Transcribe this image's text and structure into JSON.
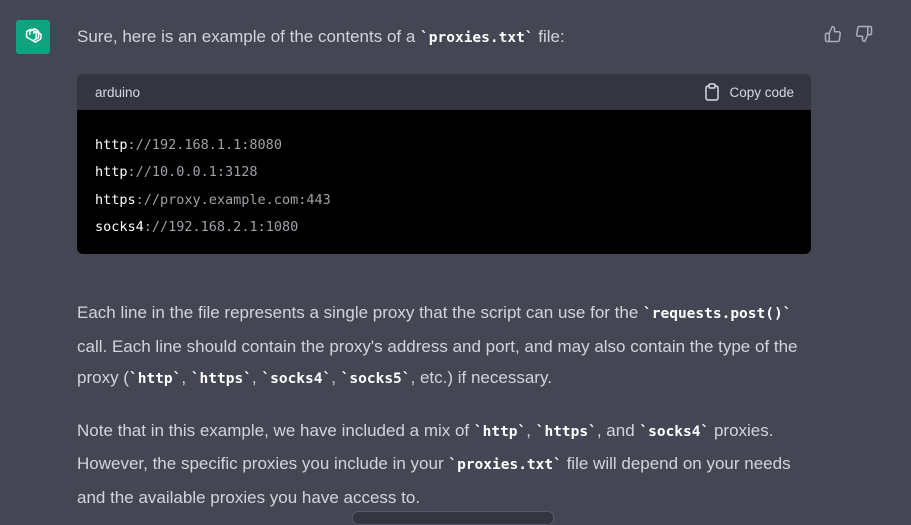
{
  "assistant": {
    "avatar_icon": "openai-logo-icon",
    "avatar_color": "#10a37f"
  },
  "message": {
    "intro_text": "Sure, here is an example of the contents of a ",
    "intro_code": "`proxies.txt`",
    "intro_suffix": " file:",
    "code_block": {
      "language": "arduino",
      "copy_label": "Copy code",
      "lines": [
        {
          "scheme": "http",
          "rest": "://192.168.1.1:8080"
        },
        {
          "scheme": "http",
          "rest": "://10.0.0.1:3128"
        },
        {
          "scheme": "https",
          "rest": "://proxy.example.com:443"
        },
        {
          "scheme": "socks4",
          "rest": "://192.168.2.1:1080"
        }
      ]
    },
    "para1": {
      "t1": "Each line in the file represents a single proxy that the script can use for the ",
      "c1": "`requests.post()`",
      "t2": " call. Each line should contain the proxy's address and port, and may also contain the type of the proxy (",
      "c2": "`http`",
      "t3": ", ",
      "c3": "`https`",
      "t4": ", ",
      "c4": "`socks4`",
      "t5": ", ",
      "c5": "`socks5`",
      "t6": ", etc.) if necessary."
    },
    "para2": {
      "t1": "Note that in this example, we have included a mix of ",
      "c1": "`http`",
      "t2": ", ",
      "c2": "`https`",
      "t3": ", and ",
      "c3": "`socks4`",
      "t4": " proxies. However, the specific proxies you include in your ",
      "c4": "`proxies.txt`",
      "t5": " file will depend on your needs and the available proxies you have access to."
    }
  },
  "actions": {
    "thumbs_up_icon": "thumbs-up-icon",
    "thumbs_down_icon": "thumbs-down-icon"
  }
}
